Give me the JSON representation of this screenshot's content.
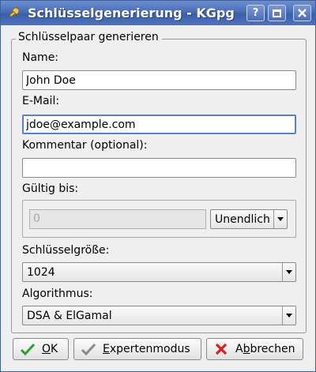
{
  "window": {
    "title": "Schlüsselgenerierung - KGpg",
    "help_label": "?",
    "accent": "#4a6db8"
  },
  "group": {
    "title": "Schlüsselpaar generieren"
  },
  "name": {
    "label": "Name:",
    "value": "John Doe"
  },
  "email": {
    "label": "E-Mail:",
    "value": "jdoe@example.com"
  },
  "comment": {
    "label": "Kommentar (optional):",
    "value": ""
  },
  "expiry": {
    "label": "Gültig bis:",
    "number": "0",
    "unit": "Unendlich"
  },
  "keysize": {
    "label": "Schlüsselgröße:",
    "value": "1024"
  },
  "algorithm": {
    "label": "Algorithmus:",
    "value": "DSA & ElGamal"
  },
  "buttons": {
    "ok": {
      "first": "O",
      "rest": "K"
    },
    "expert": {
      "first": "E",
      "rest": "xpertenmodus"
    },
    "cancel": {
      "pre": "A",
      "mnemonic": "b",
      "rest": "brechen"
    }
  },
  "icons": {
    "app": "key-icon",
    "ok": "checkmark-icon",
    "expert": "checkmark-icon",
    "cancel": "cross-icon"
  }
}
